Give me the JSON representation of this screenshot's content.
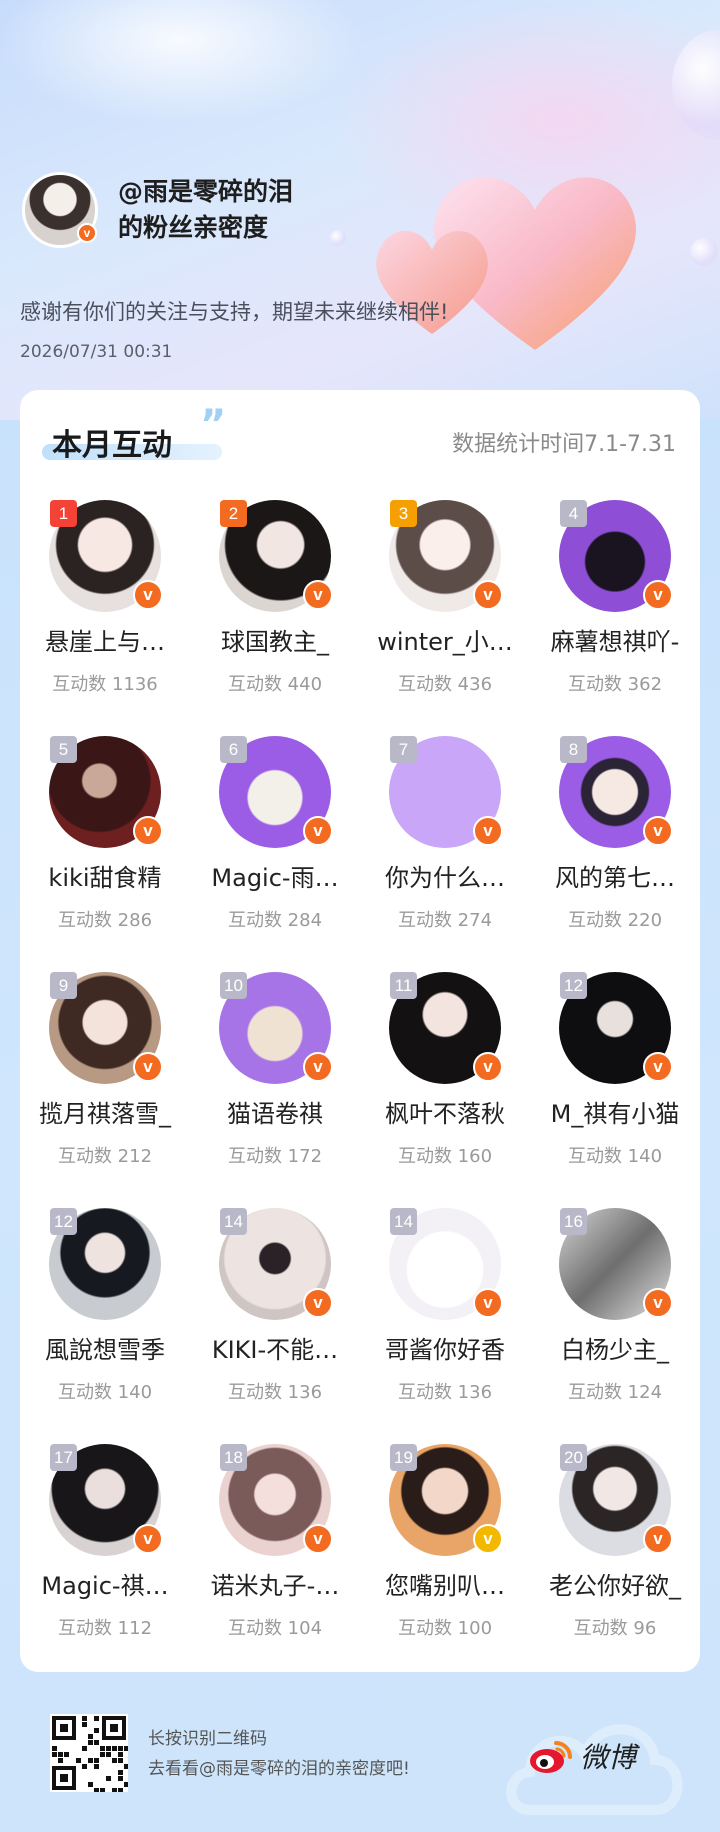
{
  "header": {
    "title_line1": "@雨是零碎的泪",
    "title_line2": "的粉丝亲密度",
    "thanks": "感谢有你们的关注与支持，期望未来继续相伴!",
    "date": "2026/07/31  00:31"
  },
  "card": {
    "section_title": "本月互动",
    "quote_glyph": "”",
    "stat_range": "数据统计时间7.1-7.31",
    "badge_glyph": "v",
    "fans": [
      {
        "rank": "1",
        "name": "悬崖上与…",
        "count": "互动数 1136",
        "rank_color": "#f44336",
        "avatar": "photo-girl",
        "badge": "orange"
      },
      {
        "rank": "2",
        "name": "球国教主_",
        "count": "互动数 440",
        "rank_color": "#f26b20",
        "avatar": "photo-girl-dark",
        "badge": "orange"
      },
      {
        "rank": "3",
        "name": "winter_小…",
        "count": "互动数 436",
        "rank_color": "#f5a000",
        "avatar": "photo-girl-light",
        "badge": "orange"
      },
      {
        "rank": "4",
        "name": "麻薯想祺吖-",
        "count": "互动数 362",
        "rank_color": "#b8b8c8",
        "avatar": "purple-cat",
        "badge": "orange"
      },
      {
        "rank": "5",
        "name": "kiki甜食精",
        "count": "互动数 286",
        "rank_color": "#b8b8c8",
        "avatar": "photo-dark-red",
        "badge": "orange"
      },
      {
        "rank": "6",
        "name": "Magic-雨…",
        "count": "互动数 284",
        "rank_color": "#b8b8c8",
        "avatar": "purple-cartoon",
        "badge": "orange"
      },
      {
        "rank": "7",
        "name": "你为什么…",
        "count": "互动数 274",
        "rank_color": "#b8b8c8",
        "avatar": "plain-lilac",
        "badge": "orange"
      },
      {
        "rank": "8",
        "name": "风的第七…",
        "count": "互动数 220",
        "rank_color": "#b8b8c8",
        "avatar": "purple-boy",
        "badge": "orange"
      },
      {
        "rank": "9",
        "name": "揽月祺落雪_",
        "count": "互动数 212",
        "rank_color": "#b8b8c8",
        "avatar": "photo-girl-brown",
        "badge": "orange"
      },
      {
        "rank": "10",
        "name": "猫语卷祺",
        "count": "互动数 172",
        "rank_color": "#b8b8c8",
        "avatar": "purple-cartoon-girl",
        "badge": "orange"
      },
      {
        "rank": "11",
        "name": "枫叶不落秋",
        "count": "互动数 160",
        "rank_color": "#b8b8c8",
        "avatar": "photo-girl-black",
        "badge": "orange"
      },
      {
        "rank": "12",
        "name": "M_祺有小猫",
        "count": "互动数 140",
        "rank_color": "#b8b8c8",
        "avatar": "photo-boy-black",
        "badge": "orange"
      },
      {
        "rank": "12",
        "name": "風說想雪季",
        "count": "互动数 140",
        "rank_color": "#b8b8c8",
        "avatar": "photo-boy-stage",
        "badge": "none"
      },
      {
        "rank": "14",
        "name": "KIKI-不能…",
        "count": "互动数 136",
        "rank_color": "#b8b8c8",
        "avatar": "photo-boy-white",
        "badge": "orange"
      },
      {
        "rank": "14",
        "name": "哥酱你好香",
        "count": "互动数 136",
        "rank_color": "#b8b8c8",
        "avatar": "cartoon-white",
        "badge": "orange"
      },
      {
        "rank": "16",
        "name": "白杨少主_",
        "count": "互动数 124",
        "rank_color": "#b8b8c8",
        "avatar": "photo-grey",
        "badge": "orange"
      },
      {
        "rank": "17",
        "name": "Magic-祺…",
        "count": "互动数 112",
        "rank_color": "#b8b8c8",
        "avatar": "photo-boy-flower",
        "badge": "orange"
      },
      {
        "rank": "18",
        "name": "诺米丸子-…",
        "count": "互动数 104",
        "rank_color": "#b8b8c8",
        "avatar": "photo-boy-pink",
        "badge": "orange"
      },
      {
        "rank": "19",
        "name": "您嘴别叭…",
        "count": "互动数 100",
        "rank_color": "#b8b8c8",
        "avatar": "photo-boy-orange",
        "badge": "gold"
      },
      {
        "rank": "20",
        "name": "老公你好欲_",
        "count": "互动数 96",
        "rank_color": "#b8b8c8",
        "avatar": "photo-girl-white",
        "badge": "orange"
      }
    ]
  },
  "footer": {
    "qr_line1": "长按识别二维码",
    "qr_line2": "去看看@雨是零碎的泪的亲密度吧!",
    "brand": "微博"
  },
  "colors": {
    "accent_orange": "#f26b20",
    "rank1": "#f44336",
    "rank2": "#f26b20",
    "rank3": "#f5a000",
    "rank_default": "#b8b8c8",
    "gold_badge": "#f3b800"
  }
}
